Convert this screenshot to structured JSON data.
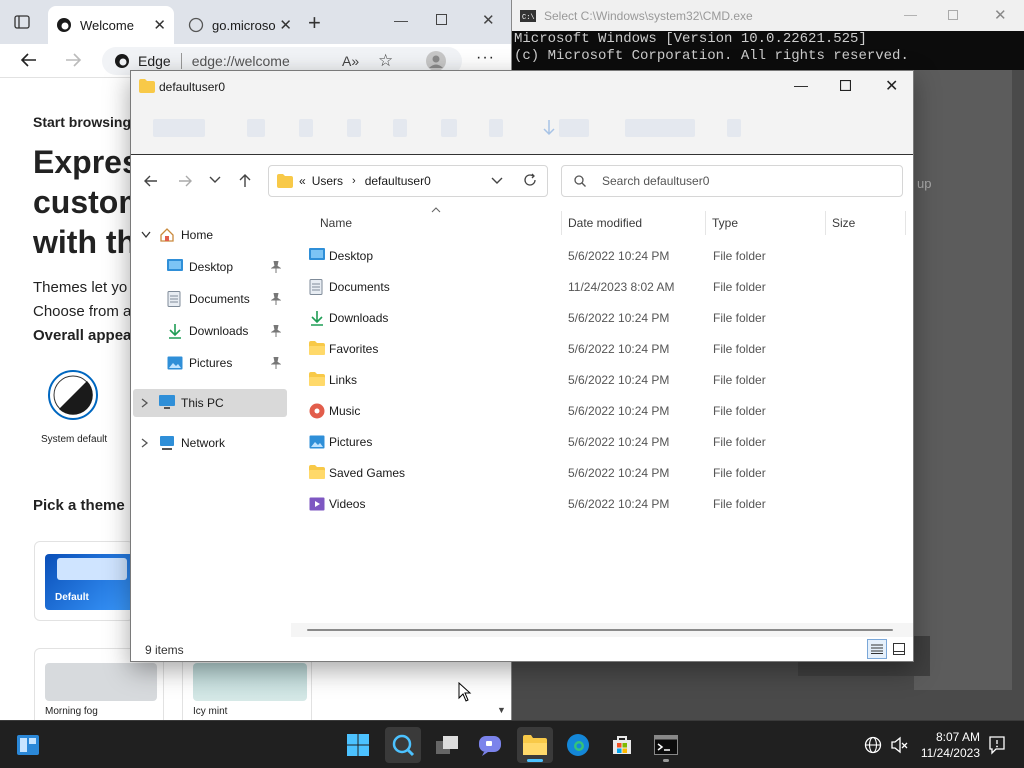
{
  "edge": {
    "tabs": [
      {
        "label": "Welcome",
        "active": true
      },
      {
        "label": "go.microso",
        "active": false
      }
    ],
    "new_tab": "+",
    "address_prefix": "Edge",
    "address_url": "edge://welcome",
    "page": {
      "start_browsing": "Start browsing",
      "headline_1": "Express",
      "headline_2": "custom",
      "headline_3": "with th",
      "body_1": "Themes let yo",
      "body_2": "Choose from a",
      "overall_appearance": "Overall appea",
      "system_default": "System default",
      "pick_theme": "Pick a theme",
      "themes": [
        "Default",
        "Morning fog",
        "Icy mint"
      ]
    }
  },
  "cmd": {
    "title": "Select C:\\Windows\\system32\\CMD.exe",
    "line_1": "Microsoft Windows [Version 10.0.22621.525]",
    "line_2": "(c) Microsoft Corporation. All rights reserved.",
    "partial_text": "up"
  },
  "explorer": {
    "title": "defaultuser0",
    "breadcrumb": {
      "prefix": "«",
      "parts": [
        "Users",
        "defaultuser0"
      ]
    },
    "search_placeholder": "Search defaultuser0",
    "sidebar": {
      "home": "Home",
      "quick": [
        "Desktop",
        "Documents",
        "Downloads",
        "Pictures"
      ],
      "this_pc": "This PC",
      "network": "Network"
    },
    "columns": {
      "name": "Name",
      "date": "Date modified",
      "type": "Type",
      "size": "Size"
    },
    "rows": [
      {
        "name": "Desktop",
        "date": "5/6/2022 10:24 PM",
        "type": "File folder",
        "icon": "desktop-folder-icon"
      },
      {
        "name": "Documents",
        "date": "11/24/2023 8:02 AM",
        "type": "File folder",
        "icon": "documents-folder-icon"
      },
      {
        "name": "Downloads",
        "date": "5/6/2022 10:24 PM",
        "type": "File folder",
        "icon": "downloads-folder-icon"
      },
      {
        "name": "Favorites",
        "date": "5/6/2022 10:24 PM",
        "type": "File folder",
        "icon": "folder-icon"
      },
      {
        "name": "Links",
        "date": "5/6/2022 10:24 PM",
        "type": "File folder",
        "icon": "folder-icon"
      },
      {
        "name": "Music",
        "date": "5/6/2022 10:24 PM",
        "type": "File folder",
        "icon": "music-folder-icon"
      },
      {
        "name": "Pictures",
        "date": "5/6/2022 10:24 PM",
        "type": "File folder",
        "icon": "pictures-folder-icon"
      },
      {
        "name": "Saved Games",
        "date": "5/6/2022 10:24 PM",
        "type": "File folder",
        "icon": "folder-icon"
      },
      {
        "name": "Videos",
        "date": "5/6/2022 10:24 PM",
        "type": "File folder",
        "icon": "videos-folder-icon"
      }
    ],
    "status": "9 items"
  },
  "taskbar": {
    "time": "8:07 AM",
    "date": "11/24/2023"
  },
  "colors": {
    "accent": "#0067c0",
    "folder_yellow": "#f8c948",
    "taskbar_bg": "#202020",
    "cmd_bg": "#0c0c0c"
  }
}
